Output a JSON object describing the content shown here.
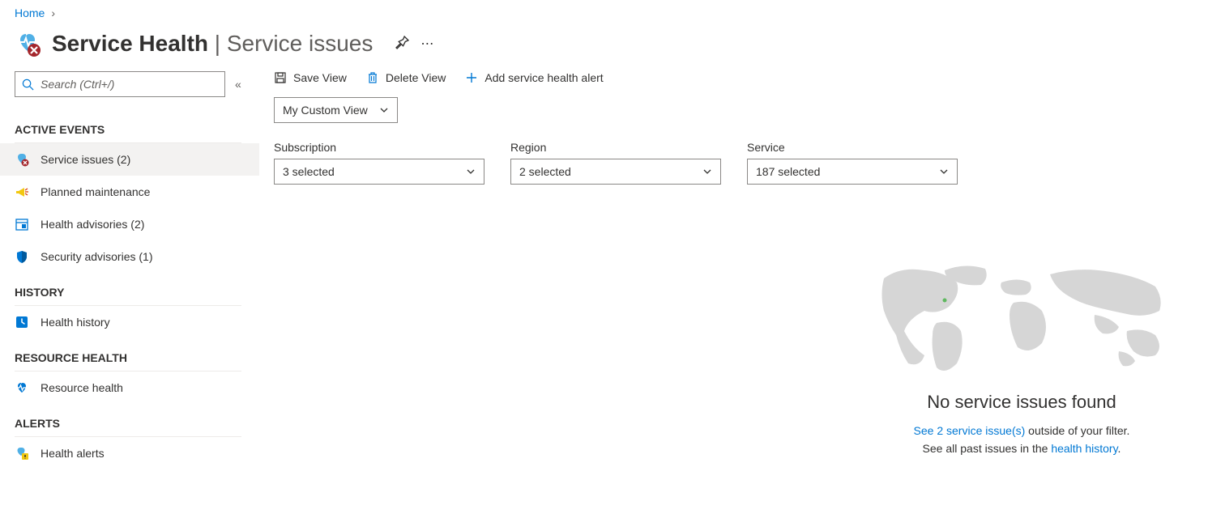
{
  "breadcrumb": {
    "home": "Home"
  },
  "header": {
    "title": "Service Health",
    "separator": "|",
    "subtitle": "Service issues"
  },
  "search": {
    "placeholder": "Search (Ctrl+/)"
  },
  "sidebar": {
    "section_active": "ACTIVE EVENTS",
    "section_history": "HISTORY",
    "section_resource": "RESOURCE HEALTH",
    "section_alerts": "ALERTS",
    "items": {
      "service_issues": "Service issues (2)",
      "planned_maintenance": "Planned maintenance",
      "health_advisories": "Health advisories (2)",
      "security_advisories": "Security advisories (1)",
      "health_history": "Health history",
      "resource_health": "Resource health",
      "health_alerts": "Health alerts"
    }
  },
  "toolbar": {
    "save_view": "Save View",
    "delete_view": "Delete View",
    "add_alert": "Add service health alert",
    "view_name": "My Custom View"
  },
  "filters": {
    "subscription_label": "Subscription",
    "subscription_value": "3 selected",
    "region_label": "Region",
    "region_value": "2 selected",
    "service_label": "Service",
    "service_value": "187 selected"
  },
  "result": {
    "heading": "No service issues found",
    "line1_link": "See 2 service issue(s)",
    "line1_rest": " outside of your filter.",
    "line2_prefix": "See all past issues in the ",
    "line2_link": "health history",
    "line2_suffix": "."
  }
}
